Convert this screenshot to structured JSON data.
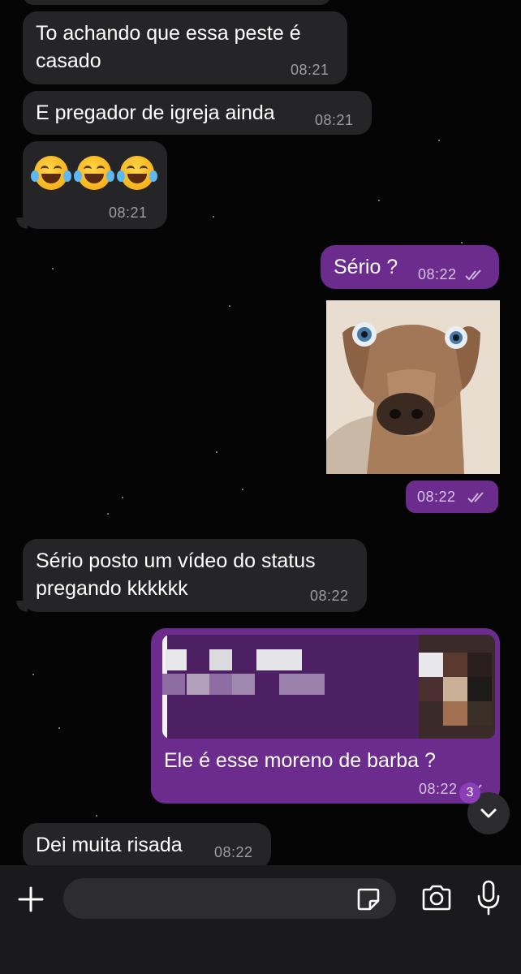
{
  "messages": [
    {
      "side": "in",
      "text_lines": [
        "To achando que essa peste é",
        "casado"
      ],
      "time": "08:21"
    },
    {
      "side": "in",
      "text": "E pregador de igreja ainda",
      "time": "08:21"
    },
    {
      "side": "in",
      "emoji": [
        "face-with-tears-of-joy",
        "face-with-tears-of-joy",
        "face-with-tears-of-joy"
      ],
      "time": "08:21"
    },
    {
      "side": "out",
      "text": "Sério ?",
      "time": "08:22",
      "status": "read"
    },
    {
      "side": "out",
      "image": "dog-bulging-eyes-meme",
      "time": "08:22",
      "status": "read"
    },
    {
      "side": "in",
      "text_lines": [
        "Sério posto um vídeo do status",
        "pregando kkkkkk"
      ],
      "time": "08:22"
    },
    {
      "side": "out",
      "quoted": "pixelated-reply-preview",
      "text": "Ele é esse moreno de barba ?",
      "time": "08:22",
      "status": "read"
    },
    {
      "side": "in",
      "text": "Dei muita risada",
      "time": "08:22"
    }
  ],
  "scroll_down": {
    "badge": "3",
    "icon": "chevron-down-icon"
  },
  "composer": {
    "attach_icon": "plus-icon",
    "sticker_icon": "sticker-icon",
    "camera_icon": "camera-icon",
    "mic_icon": "microphone-icon",
    "input_value": ""
  },
  "colors": {
    "background": "#050506",
    "incoming": "#252527",
    "outgoing": "#6b2c8e",
    "accent": "#8a3fb8"
  }
}
